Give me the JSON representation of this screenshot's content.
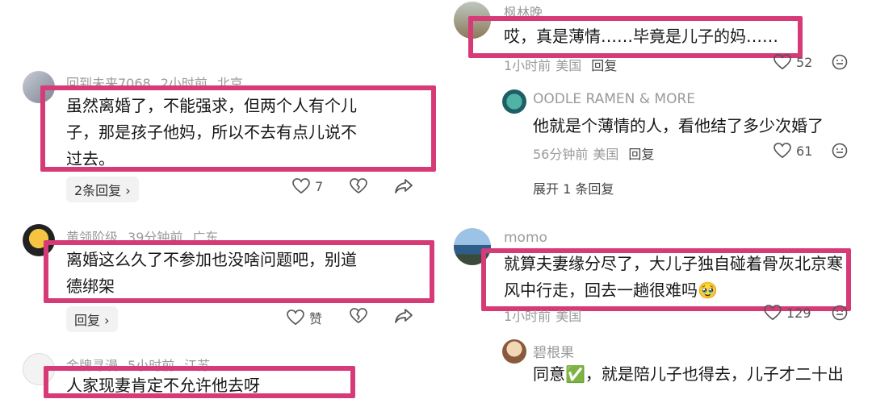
{
  "left": {
    "c1": {
      "username": "回到未来7068",
      "time": "2小时前",
      "location": "北京",
      "text_l1": "虽然离婚了，不能强求，但两个人有个儿",
      "text_l2": "子，那是孩子他妈，所以不去有点儿说不",
      "text_l3": "过去。",
      "replies": "2条回复 ›",
      "likes": "7"
    },
    "c2": {
      "username": "黄领阶级",
      "time": "39分钟前",
      "location": "广东",
      "text_l1": "离婚这么久了不参加也没啥问题吧，别道",
      "text_l2": "德绑架",
      "replies": "回复 ›",
      "likes": "赞"
    },
    "c3": {
      "username": "金牌寻漫",
      "time": "5小时前",
      "location": "江苏",
      "text_l1": "人家现妻肯定不允许他去呀"
    }
  },
  "right": {
    "c1": {
      "username": "枫林晚",
      "text": "哎，真是薄情……毕竟是儿子的妈……",
      "time": "1小时前",
      "location": "美国",
      "reply": "回复",
      "likes": "52"
    },
    "r1": {
      "username": "OODLE RAMEN & MORE",
      "text": "他就是个薄情的人，看他结了多少次婚了",
      "time": "56分钟前",
      "location": "美国",
      "reply": "回复",
      "likes": "61"
    },
    "expand": "展开 1 条回复",
    "c2": {
      "username": "momo",
      "text_l1": "就算夫妻缘分尽了，大儿子独自碰着骨灰北京寒",
      "text_l2": "风中行走，回去一趟很难吗🥹",
      "time": "1小时前",
      "location": "美国",
      "likes": "129"
    },
    "r2": {
      "username": "碧根果",
      "text_prefix": "同意",
      "check": "✅",
      "text_rest": "，就是陪儿子也得去，儿子才二十出"
    }
  },
  "colors": {
    "highlight": "#d63a77",
    "meta_text": "#9a9a9a",
    "body_text": "#161616"
  }
}
